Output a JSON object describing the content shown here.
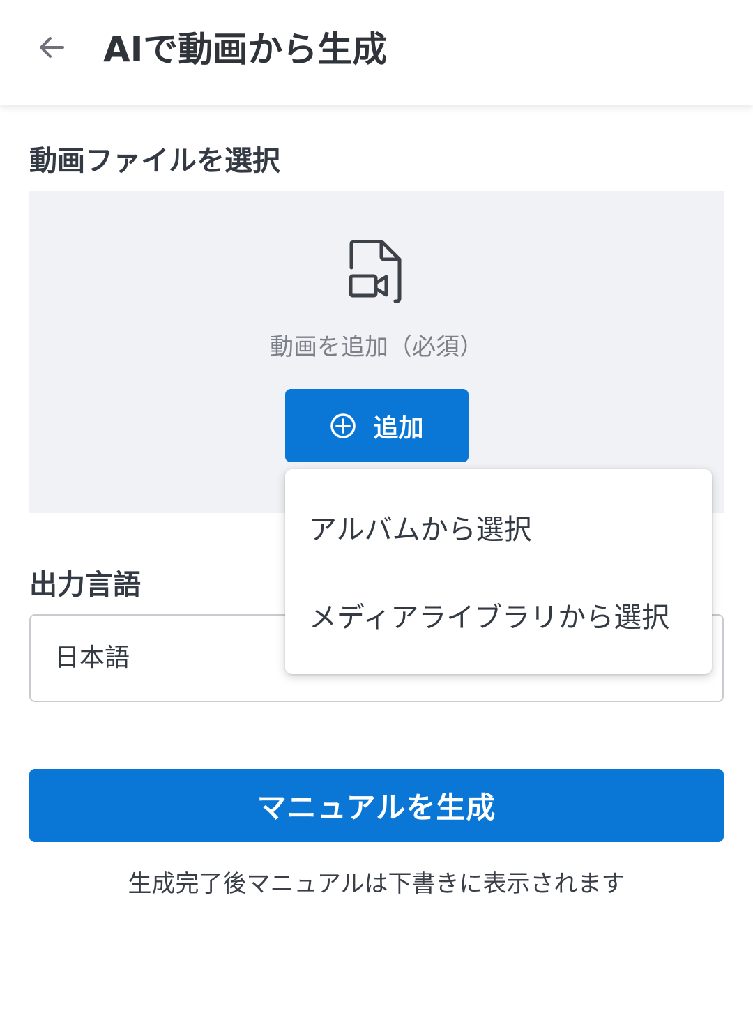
{
  "appbar": {
    "title": "AIで動画から生成",
    "back_icon": "arrow-left-icon"
  },
  "video_section": {
    "label": "動画ファイルを選択",
    "file_icon": "video-file-icon",
    "hint": "動画を追加（必須）",
    "add_button": {
      "icon": "plus-circle-icon",
      "label": "追加"
    }
  },
  "menu": {
    "items": [
      {
        "label": "アルバムから選択"
      },
      {
        "label": "メディアライブラリから選択"
      }
    ]
  },
  "language_section": {
    "label": "出力言語",
    "selected": "日本語"
  },
  "generate_button": {
    "label": "マニュアルを生成"
  },
  "note": "生成完了後マニュアルは下書きに表示されます",
  "colors": {
    "primary": "#0a76d6",
    "upload_bg": "#f0f2f6",
    "text": "#333a44",
    "hint": "#7c8088"
  }
}
